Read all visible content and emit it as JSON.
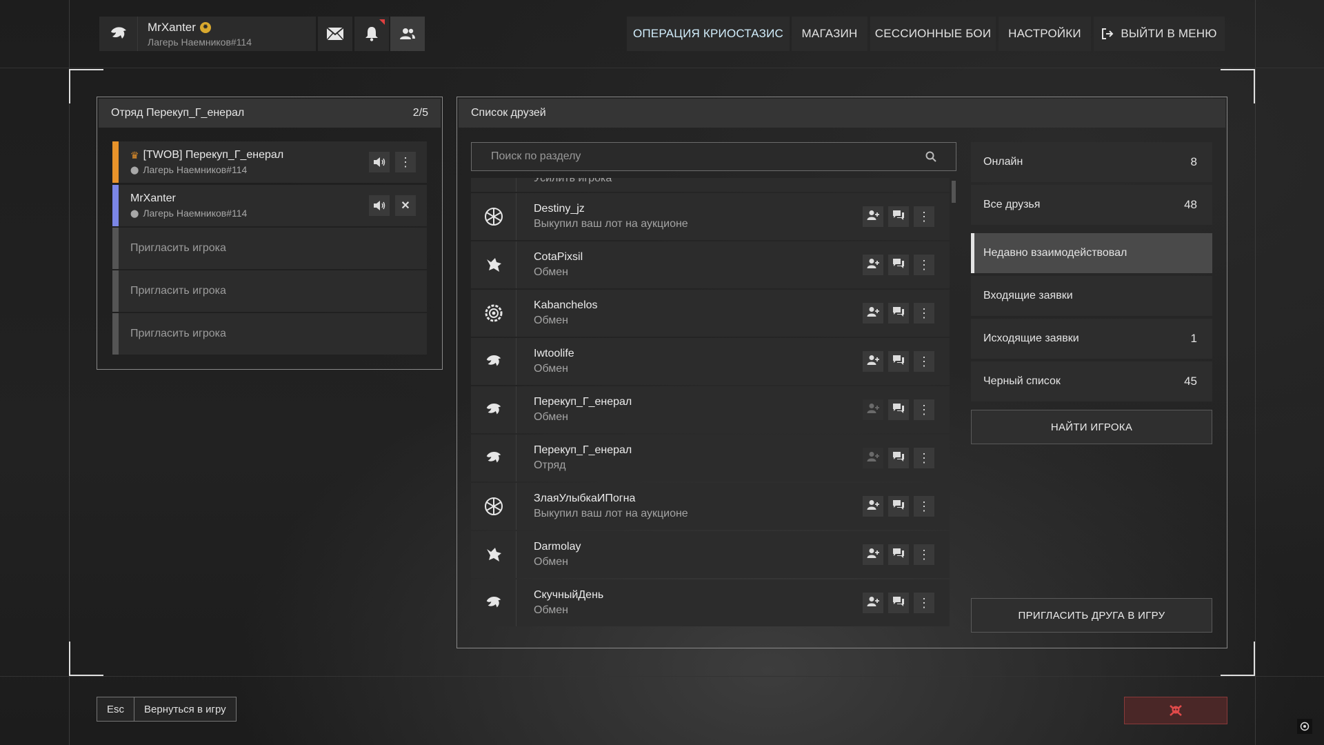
{
  "profile": {
    "name": "MrXanter",
    "sub": "Лагерь Наемников#114"
  },
  "nav": {
    "items": [
      {
        "label": "ОПЕРАЦИЯ КРИОСТАЗИС"
      },
      {
        "label": "МАГАЗИН"
      },
      {
        "label": "СЕССИОННЫЕ БОИ"
      },
      {
        "label": "НАСТРОЙКИ"
      },
      {
        "label": "ВЫЙТИ В МЕНЮ"
      }
    ]
  },
  "squad": {
    "title": "Отряд Перекуп_Г_енерал",
    "count": "2/5",
    "members": [
      {
        "name": "[TWOB] Перекуп_Г_енерал",
        "sub": "Лагерь Наемников#114"
      },
      {
        "name": "MrXanter",
        "sub": "Лагерь Наемников#114"
      }
    ],
    "invite_label": "Пригласить игрока"
  },
  "friends": {
    "title": "Список друзей",
    "search_placeholder": "Поиск по разделу",
    "partial_top": "Усилить игрока",
    "list": [
      {
        "name": "Destiny_jz",
        "status": "Выкупил ваш лот на аукционе",
        "icon": "snowflake-icon"
      },
      {
        "name": "CotaPixsil",
        "status": "Обмен",
        "icon": "wolf-icon"
      },
      {
        "name": "Kabanchelos",
        "status": "Обмен",
        "icon": "gear-emblem-icon"
      },
      {
        "name": "Iwtoolife",
        "status": "Обмен",
        "icon": "eagle-icon"
      },
      {
        "name": "Перекуп_Г_енерал",
        "status": "Обмен",
        "icon": "eagle-icon"
      },
      {
        "name": "Перекуп_Г_енерал",
        "status": "Отряд",
        "icon": "eagle-icon"
      },
      {
        "name": "ЗлаяУлыбкаИПогна",
        "status": "Выкупил ваш лот на аукционе",
        "icon": "snowflake-icon"
      },
      {
        "name": "Darmolay",
        "status": "Обмен",
        "icon": "wolf-icon"
      },
      {
        "name": "СкучныйДень",
        "status": "Обмен",
        "icon": "eagle-icon"
      }
    ]
  },
  "categories": [
    {
      "label": "Онлайн",
      "count": "8"
    },
    {
      "label": "Все друзья",
      "count": "48"
    },
    {
      "label": "Недавно взаимодействовал",
      "count": ""
    },
    {
      "label": "Входящие заявки",
      "count": ""
    },
    {
      "label": "Исходящие заявки",
      "count": "1"
    },
    {
      "label": "Черный список",
      "count": "45"
    }
  ],
  "find_player": "НАЙТИ ИГРОКА",
  "invite_friend": "ПРИГЛАСИТЬ ДРУГА В ИГРУ",
  "bottom": {
    "esc": "Esc",
    "back": "Вернуться в игру"
  },
  "colors": {
    "leader_strip": "#e8932a",
    "self_strip": "#7b86e6",
    "invite_strip": "#555555",
    "danger": "#e04a4a"
  }
}
